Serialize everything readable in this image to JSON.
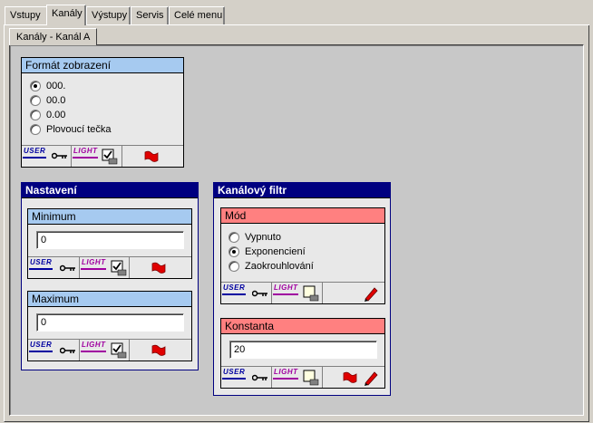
{
  "tabs": [
    "Vstupy",
    "Kanály",
    "Výstupy",
    "Servis",
    "Celé menu"
  ],
  "subtab": "Kanály - Kanál A",
  "format": {
    "title": "Formát zobrazení",
    "options": [
      "000.",
      "00.0",
      "0.00",
      "Plovoucí tečka"
    ],
    "selected": 0
  },
  "nastaveni": {
    "title": "Nastavení",
    "minimum": {
      "title": "Minimum",
      "value": "0"
    },
    "maximum": {
      "title": "Maximum",
      "value": "0"
    }
  },
  "filtr": {
    "title": "Kanálový filtr",
    "mod": {
      "title": "Mód",
      "options": [
        "Vypnuto",
        "Exponenciení",
        "Zaokrouhlování"
      ],
      "selected": 1
    },
    "konstanta": {
      "title": "Konstanta",
      "value": "20"
    }
  },
  "toolbar": {
    "user": "USER",
    "light": "LIGHT"
  },
  "colors": {
    "user": "#0000a0",
    "light": "#a000a0",
    "header_blue": "#a6caf0",
    "header_red": "#ff8080",
    "header_navy": "#000080"
  }
}
